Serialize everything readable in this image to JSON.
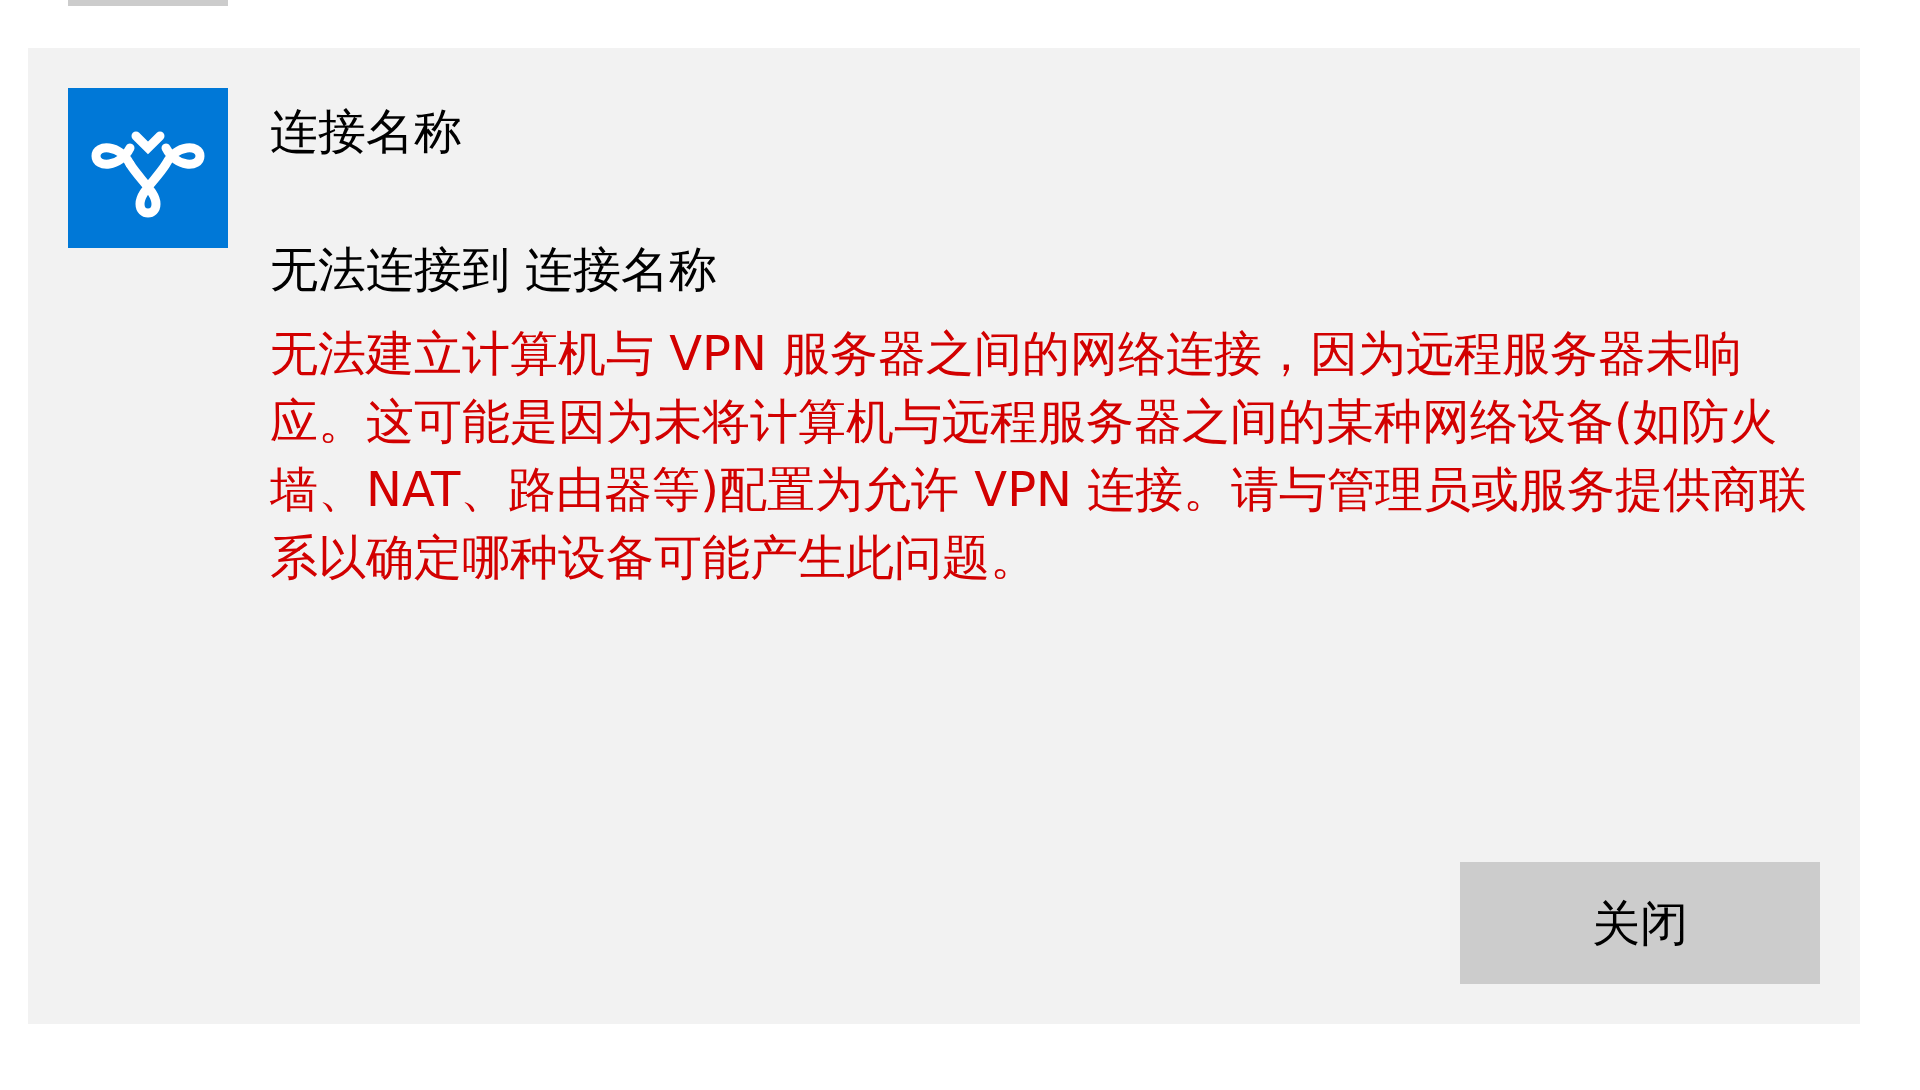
{
  "dialog": {
    "connection_name": "连接名称",
    "heading": "无法连接到 连接名称",
    "error_message": "无法建立计算机与 VPN 服务器之间的网络连接，因为远程服务器未响应。这可能是因为未将计算机与远程服务器之间的某种网络设备(如防火墙、NAT、路由器等)配置为允许 VPN 连接。请与管理员或服务提供商联系以确定哪种设备可能产生此问题。",
    "buttons": [
      "关闭"
    ]
  }
}
